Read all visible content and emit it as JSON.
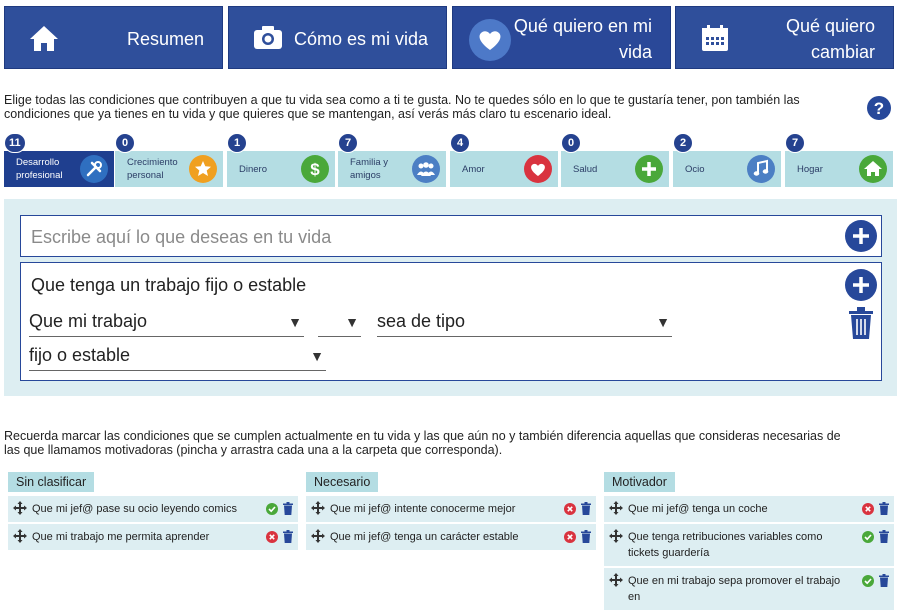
{
  "nav": [
    {
      "label": "Resumen",
      "icon": "home-icon"
    },
    {
      "label": "Cómo es mi vida",
      "icon": "camera-icon"
    },
    {
      "label": "Qué quiero en mi vida",
      "icon": "heart-icon"
    },
    {
      "label": "Qué quiero cambiar",
      "icon": "calendar-icon"
    }
  ],
  "intro": "Elige todas las condiciones que contribuyen a que tu vida sea como a ti te gusta. No te quedes sólo en lo que te gustaría tener, pon también las condiciones que ya tienes en tu vida y que quieres que se mantengan, así verás más claro tu escenario ideal.",
  "categories": [
    {
      "count": "11",
      "name": "Desarrollo profesional",
      "icon": "tools-icon",
      "color": "#2f6fc0"
    },
    {
      "count": "0",
      "name": "Crecimiento personal",
      "icon": "star-icon",
      "color": "#f0a020"
    },
    {
      "count": "1",
      "name": "Dinero",
      "icon": "dollar-icon",
      "color": "#4aa83a"
    },
    {
      "count": "7",
      "name": "Familia y amigos",
      "icon": "group-icon",
      "color": "#4c7fc4"
    },
    {
      "count": "4",
      "name": "Amor",
      "icon": "heart-icon",
      "color": "#d9333f"
    },
    {
      "count": "0",
      "name": "Salud",
      "icon": "plus-icon",
      "color": "#4aa83a"
    },
    {
      "count": "2",
      "name": "Ocio",
      "icon": "music-icon",
      "color": "#4c7fc4"
    },
    {
      "count": "7",
      "name": "Hogar",
      "icon": "house-icon",
      "color": "#4aa83a"
    }
  ],
  "editor": {
    "placeholder": "Escribe aquí lo que deseas en tu vida",
    "title": "Que tenga un trabajo fijo o estable",
    "select1": "Que mi trabajo",
    "select2": "",
    "select3": "sea de tipo",
    "select4": "fijo o estable"
  },
  "reminder": "Recuerda marcar las condiciones que se cumplen actualmente en tu vida y las que aún no y también diferencia aquellas que consideras necesarias de las que llamamos motivadoras (pincha y arrastra cada una a la carpeta que corresponda).",
  "columns": [
    {
      "title": "Sin clasificar",
      "items": [
        {
          "text": "Que mi jef@ pase su ocio leyendo comics",
          "status": "ok"
        },
        {
          "text": "Que mi trabajo me permita aprender",
          "status": "no"
        }
      ]
    },
    {
      "title": "Necesario",
      "items": [
        {
          "text": "Que mi jef@ intente conocerme mejor",
          "status": "no"
        },
        {
          "text": "Que mi jef@ tenga un carácter estable",
          "status": "no"
        }
      ]
    },
    {
      "title": "Motivador",
      "items": [
        {
          "text": "Que mi jef@ tenga un coche",
          "status": "no"
        },
        {
          "text": "Que tenga retribuciones variables como tickets guardería",
          "status": "ok"
        },
        {
          "text": "Que en mi trabajo sepa promover el trabajo en",
          "status": "ok"
        }
      ]
    }
  ],
  "colors": {
    "navy": "#2f4f9b",
    "light": "#b4dde3",
    "panel": "#ddeef2",
    "ok": "#4aa83a",
    "no": "#d9333f"
  }
}
